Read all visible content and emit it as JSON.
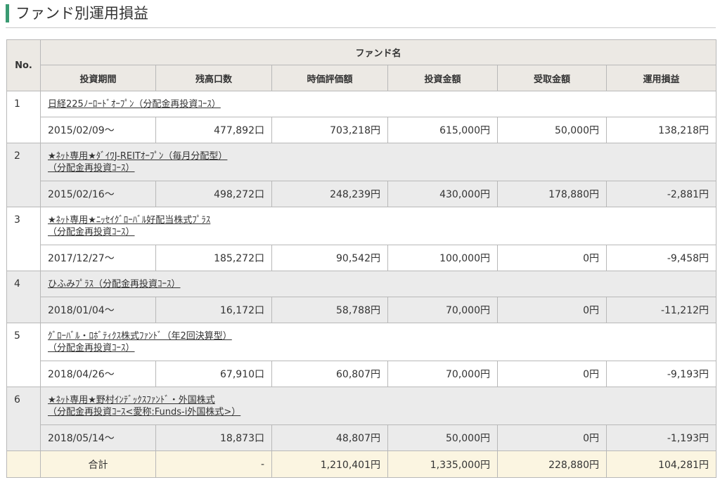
{
  "page": {
    "title": "ファンド別運用損益",
    "accent_color": "#3a9a72"
  },
  "table": {
    "headers": {
      "no": "No.",
      "fund_name": "ファンド名",
      "period": "投資期間",
      "units": "残高口数",
      "market_value": "時価評価額",
      "invested": "投資金額",
      "received": "受取金額",
      "profit": "運用損益"
    },
    "rows": [
      {
        "no": "1",
        "name_line1": "日経225ﾉｰﾛｰﾄﾞｵｰﾌﾟﾝ（分配金再投資ｺｰｽ）",
        "name_line2": "",
        "period": "2015/02/09〜",
        "units": "477,892口",
        "market_value": "703,218円",
        "invested": "615,000円",
        "received": "50,000円",
        "profit": "138,218円"
      },
      {
        "no": "2",
        "name_line1": "★ﾈｯﾄ専用★ﾀﾞｲﾜJ-REITｵｰﾌﾟﾝ（毎月分配型）",
        "name_line2": "（分配金再投資ｺｰｽ）",
        "period": "2015/02/16〜",
        "units": "498,272口",
        "market_value": "248,239円",
        "invested": "430,000円",
        "received": "178,880円",
        "profit": "-2,881円"
      },
      {
        "no": "3",
        "name_line1": "★ﾈｯﾄ専用★ﾆｯｾｲｸﾞﾛｰﾊﾞﾙ好配当株式ﾌﾟﾗｽ",
        "name_line2": "（分配金再投資ｺｰｽ）",
        "period": "2017/12/27〜",
        "units": "185,272口",
        "market_value": "90,542円",
        "invested": "100,000円",
        "received": "0円",
        "profit": "-9,458円"
      },
      {
        "no": "4",
        "name_line1": "ひふみﾌﾟﾗｽ（分配金再投資ｺｰｽ）",
        "name_line2": "",
        "period": "2018/01/04〜",
        "units": "16,172口",
        "market_value": "58,788円",
        "invested": "70,000円",
        "received": "0円",
        "profit": "-11,212円"
      },
      {
        "no": "5",
        "name_line1": "ｸﾞﾛｰﾊﾞﾙ・ﾛﾎﾞﾃｨｸｽ株式ﾌｧﾝﾄﾞ（年2回決算型）",
        "name_line2": "（分配金再投資ｺｰｽ）",
        "period": "2018/04/26〜",
        "units": "67,910口",
        "market_value": "60,807円",
        "invested": "70,000円",
        "received": "0円",
        "profit": "-9,193円"
      },
      {
        "no": "6",
        "name_line1": "★ﾈｯﾄ専用★野村ｲﾝﾃﾞｯｸｽﾌｧﾝﾄﾞ・外国株式",
        "name_line2": "（分配金再投資ｺｰｽ<愛称:Funds-i外国株式>）",
        "period": "2018/05/14〜",
        "units": "18,873口",
        "market_value": "48,807円",
        "invested": "50,000円",
        "received": "0円",
        "profit": "-1,193円"
      }
    ],
    "total": {
      "label": "合計",
      "units": "-",
      "market_value": "1,210,401円",
      "invested": "1,335,000円",
      "received": "228,880円",
      "profit": "104,281円"
    }
  }
}
